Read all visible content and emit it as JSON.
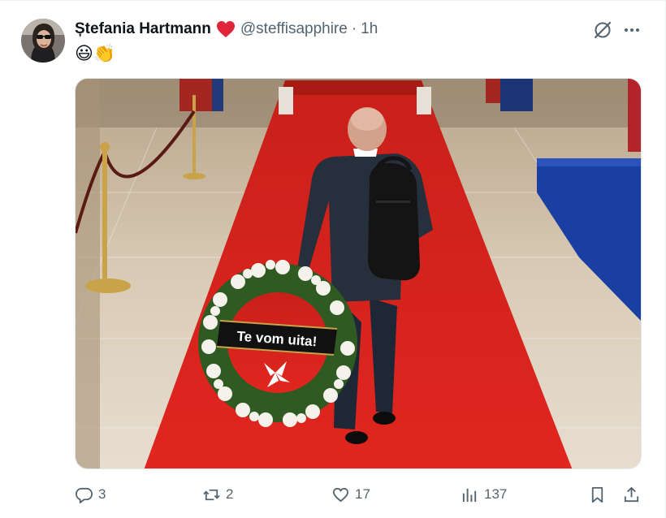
{
  "tweet": {
    "author_name": "Ștefania Hartmann",
    "author_handle": "@steffisapphire",
    "separator": "·",
    "time": "1h",
    "text": "😃👏",
    "image": {
      "banner_text": "Te vom uita!"
    },
    "stats": {
      "replies": "3",
      "reposts": "2",
      "likes": "17",
      "views": "137"
    }
  },
  "icons": {
    "verified_heart": "red-heart-icon",
    "grok": "grok-icon",
    "more": "more-icon",
    "reply": "reply-icon",
    "repost": "repost-icon",
    "like": "like-icon",
    "views": "views-icon",
    "bookmark": "bookmark-icon",
    "share": "share-icon"
  },
  "colors": {
    "text": "#0f1419",
    "secondary": "#536471",
    "heart": "#e0243a",
    "carpet": "#d9221c"
  }
}
